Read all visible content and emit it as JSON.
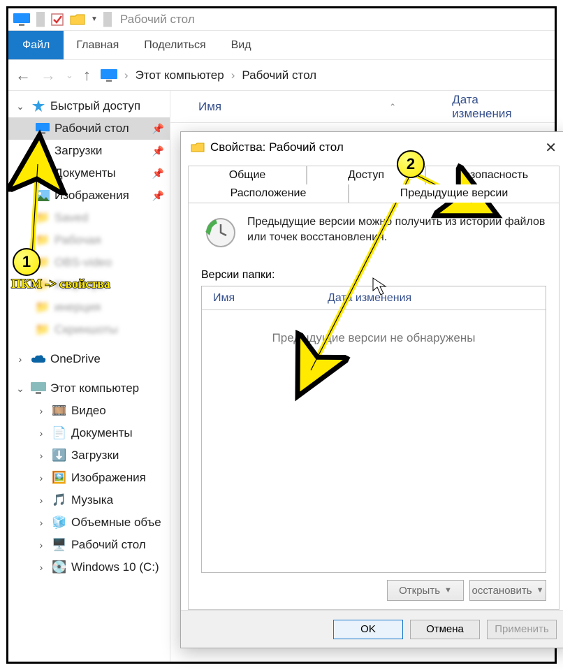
{
  "window": {
    "title": "Рабочий стол"
  },
  "ribbon": {
    "file": "Файл",
    "tabs": [
      "Главная",
      "Поделиться",
      "Вид"
    ]
  },
  "breadcrumb": {
    "root": "Этот компьютер",
    "leaf": "Рабочий стол"
  },
  "columns": {
    "name_col": "Имя",
    "date_col": "Дата изменения"
  },
  "sidebar": {
    "quick_access": "Быстрый доступ",
    "quick_items": [
      {
        "label": "Рабочий стол",
        "icon": "desktop",
        "pinned": true,
        "selected": true
      },
      {
        "label": "Загрузки",
        "icon": "download",
        "pinned": true
      },
      {
        "label": "Документы",
        "icon": "docs",
        "pinned": true
      },
      {
        "label": "Изображения",
        "icon": "pictures",
        "pinned": true
      }
    ],
    "onedrive": "OneDrive",
    "this_pc": "Этот компьютер",
    "pc_items": [
      {
        "label": "Видео",
        "icon": "video"
      },
      {
        "label": "Документы",
        "icon": "docs"
      },
      {
        "label": "Загрузки",
        "icon": "download"
      },
      {
        "label": "Изображения",
        "icon": "pictures"
      },
      {
        "label": "Музыка",
        "icon": "music"
      },
      {
        "label": "Объемные объе",
        "icon": "3d"
      },
      {
        "label": "Рабочий стол",
        "icon": "desktop"
      },
      {
        "label": "Windows 10 (C:)",
        "icon": "disk"
      }
    ]
  },
  "dialog": {
    "title": "Свойства: Рабочий стол",
    "tabs_row1": [
      "Общие",
      "Доступ",
      "Безопасность"
    ],
    "tabs_row2": [
      "Расположение",
      "Предыдущие версии"
    ],
    "active_tab": "Предыдущие версии",
    "description": "Предыдущие версии можно получить из истории файлов или точек восстановления.",
    "versions_label": "Версии папки:",
    "list_cols": {
      "name": "Имя",
      "date": "Дата изменения"
    },
    "empty_text": "Предыдущие версии не обнаружены",
    "open_btn": "Открыть",
    "restore_btn": "осстановить",
    "ok": "OK",
    "cancel": "Отмена",
    "apply": "Применить"
  },
  "annotations": {
    "badge1": "1",
    "badge2": "2",
    "hint": "ПКМ -> свойства"
  }
}
